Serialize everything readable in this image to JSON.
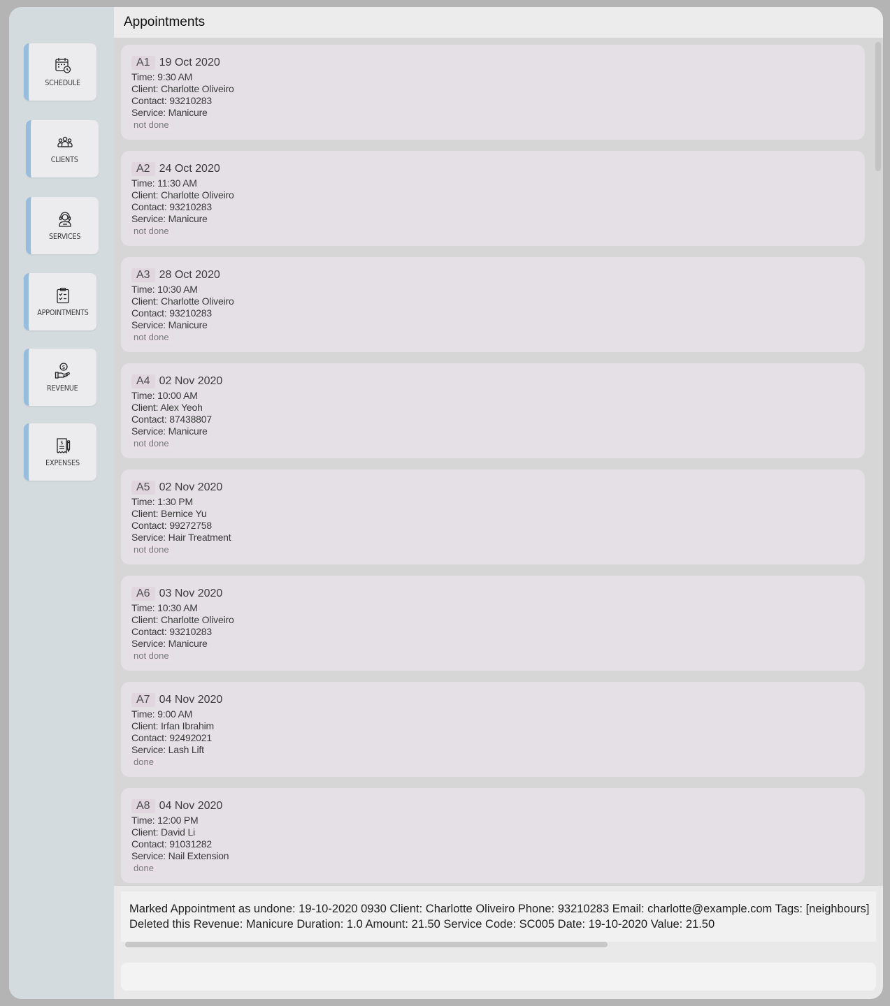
{
  "header": {
    "title": "Appointments"
  },
  "sidebar": {
    "items": [
      {
        "label": "SCHEDULE",
        "icon": "calendar-clock-icon"
      },
      {
        "label": "CLIENTS",
        "icon": "people-icon"
      },
      {
        "label": "SERVICES",
        "icon": "support-agent-icon"
      },
      {
        "label": "APPOINTMENTS",
        "icon": "clipboard-check-icon"
      },
      {
        "label": "REVENUE",
        "icon": "hand-dollar-icon"
      },
      {
        "label": "EXPENSES",
        "icon": "receipt-icon"
      }
    ],
    "accent": "#98bcdc"
  },
  "appointments": [
    {
      "id": "A1",
      "date": "19 Oct 2020",
      "time": "Time: 9:30 AM",
      "client": "Client: Charlotte Oliveiro",
      "contact": "Contact: 93210283",
      "service": "Service: Manicure",
      "status": "not done"
    },
    {
      "id": "A2",
      "date": "24 Oct 2020",
      "time": "Time: 11:30 AM",
      "client": "Client: Charlotte Oliveiro",
      "contact": "Contact: 93210283",
      "service": "Service: Manicure",
      "status": "not done"
    },
    {
      "id": "A3",
      "date": "28 Oct 2020",
      "time": "Time: 10:30 AM",
      "client": "Client: Charlotte Oliveiro",
      "contact": "Contact: 93210283",
      "service": "Service: Manicure",
      "status": "not done"
    },
    {
      "id": "A4",
      "date": "02 Nov 2020",
      "time": "Time: 10:00 AM",
      "client": "Client: Alex Yeoh",
      "contact": "Contact: 87438807",
      "service": "Service: Manicure",
      "status": "not done"
    },
    {
      "id": "A5",
      "date": "02 Nov 2020",
      "time": "Time: 1:30 PM",
      "client": "Client: Bernice Yu",
      "contact": "Contact: 99272758",
      "service": "Service: Hair Treatment",
      "status": "not done"
    },
    {
      "id": "A6",
      "date": "03 Nov 2020",
      "time": "Time: 10:30 AM",
      "client": "Client: Charlotte Oliveiro",
      "contact": "Contact: 93210283",
      "service": "Service: Manicure",
      "status": "not done"
    },
    {
      "id": "A7",
      "date": "04 Nov 2020",
      "time": "Time: 9:00 AM",
      "client": "Client: Irfan Ibrahim",
      "contact": "Contact: 92492021",
      "service": "Service: Lash Lift",
      "status": "done"
    },
    {
      "id": "A8",
      "date": "04 Nov 2020",
      "time": "Time: 12:00 PM",
      "client": "Client: David Li",
      "contact": "Contact: 91031282",
      "service": "Service: Nail Extension",
      "status": "done"
    }
  ],
  "result": {
    "line1": "Marked Appointment as undone: 19-10-2020 0930 Client: Charlotte Oliveiro Phone: 93210283 Email: charlotte@example.com Tags: [neighbours]",
    "line2": "Deleted this Revenue: Manicure Duration: 1.0 Amount: 21.50 Service Code: SC005 Date: 19-10-2020 Value: 21.50"
  },
  "command": {
    "value": ""
  }
}
